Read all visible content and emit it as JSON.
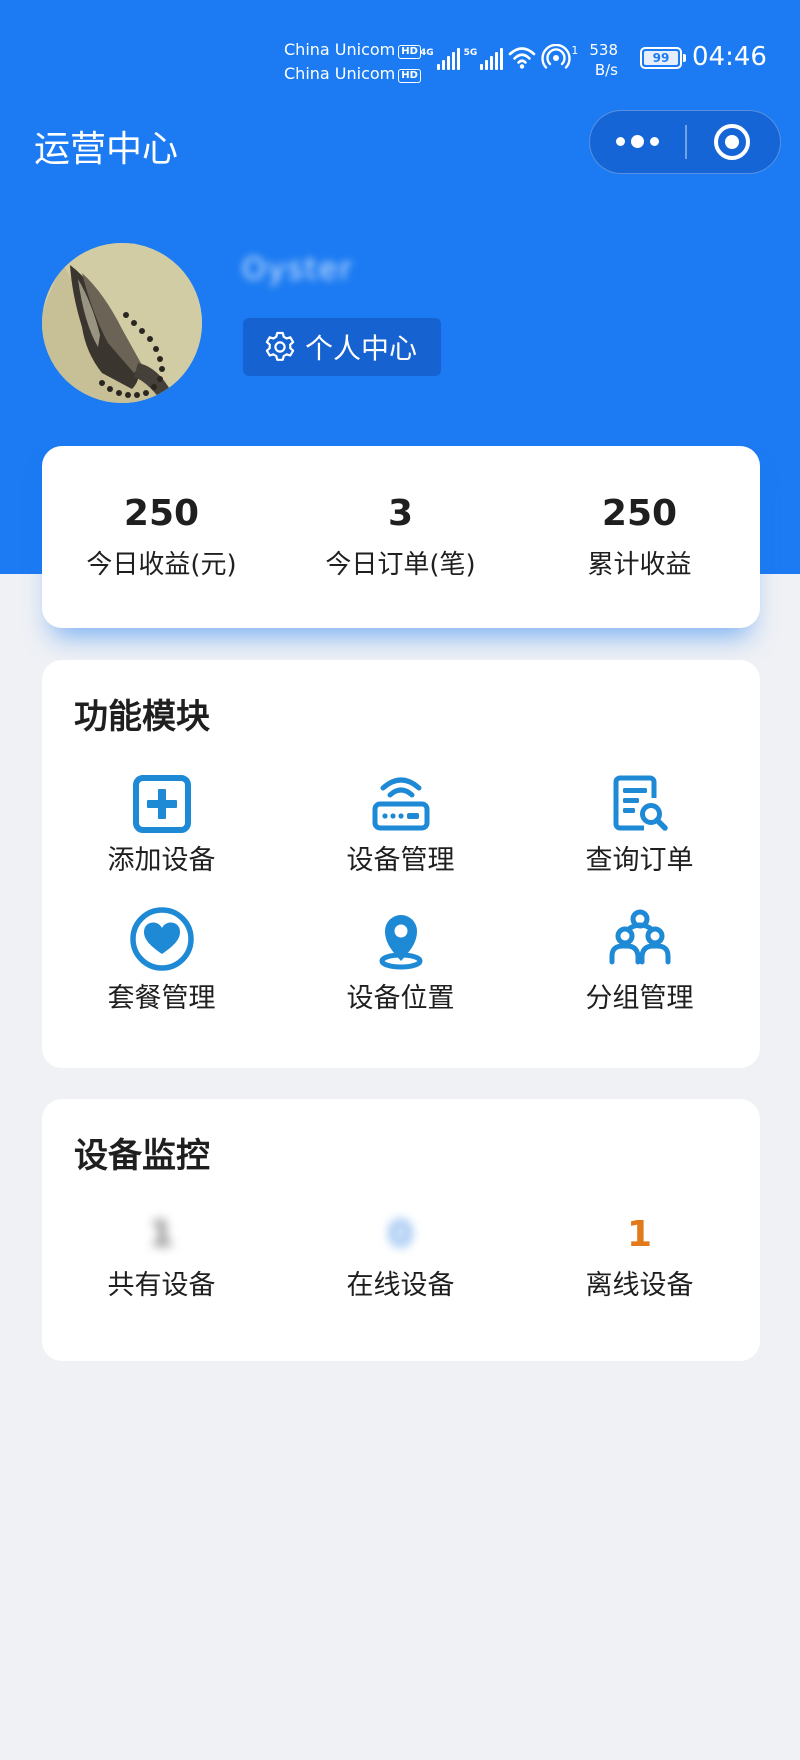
{
  "status_bar": {
    "carrier_1": "China Unicom",
    "carrier_2": "China Unicom",
    "hd_badge": "HD",
    "signal_1_tag": "4G",
    "signal_2_tag": "5G",
    "hotspot_count": "1",
    "net_speed_value": "538",
    "net_speed_unit": "B/s",
    "battery_level": "99",
    "time": "04:46",
    "icons": [
      "signal-icon",
      "wifi-icon",
      "hotspot-icon",
      "battery-icon"
    ]
  },
  "nav": {
    "title": "运营中心",
    "capsule_icons": [
      "more-icon",
      "close-target-icon"
    ]
  },
  "profile": {
    "username": "Oyster",
    "center_button_label": "个人中心",
    "button_icon": "gear-icon"
  },
  "stats": [
    {
      "value": "250",
      "label": "今日收益(元)"
    },
    {
      "value": "3",
      "label": "今日订单(笔)"
    },
    {
      "value": "250",
      "label": "累计收益"
    }
  ],
  "functions": {
    "title": "功能模块",
    "items": [
      {
        "label": "添加设备",
        "icon": "add-box-icon"
      },
      {
        "label": "设备管理",
        "icon": "router-icon"
      },
      {
        "label": "查询订单",
        "icon": "order-search-icon"
      },
      {
        "label": "套餐管理",
        "icon": "heart-icon"
      },
      {
        "label": "设备位置",
        "icon": "location-pin-icon"
      },
      {
        "label": "分组管理",
        "icon": "group-icon"
      }
    ]
  },
  "monitor": {
    "title": "设备监控",
    "items": [
      {
        "value": "1",
        "label": "共有设备"
      },
      {
        "value": "0",
        "label": "在线设备"
      },
      {
        "value": "1",
        "label": "离线设备"
      }
    ]
  },
  "colors": {
    "brand_blue": "#1c7bf2",
    "icon_blue": "#1e8ad6",
    "offline_orange": "#e27a1a",
    "page_bg": "#eff1f5"
  }
}
